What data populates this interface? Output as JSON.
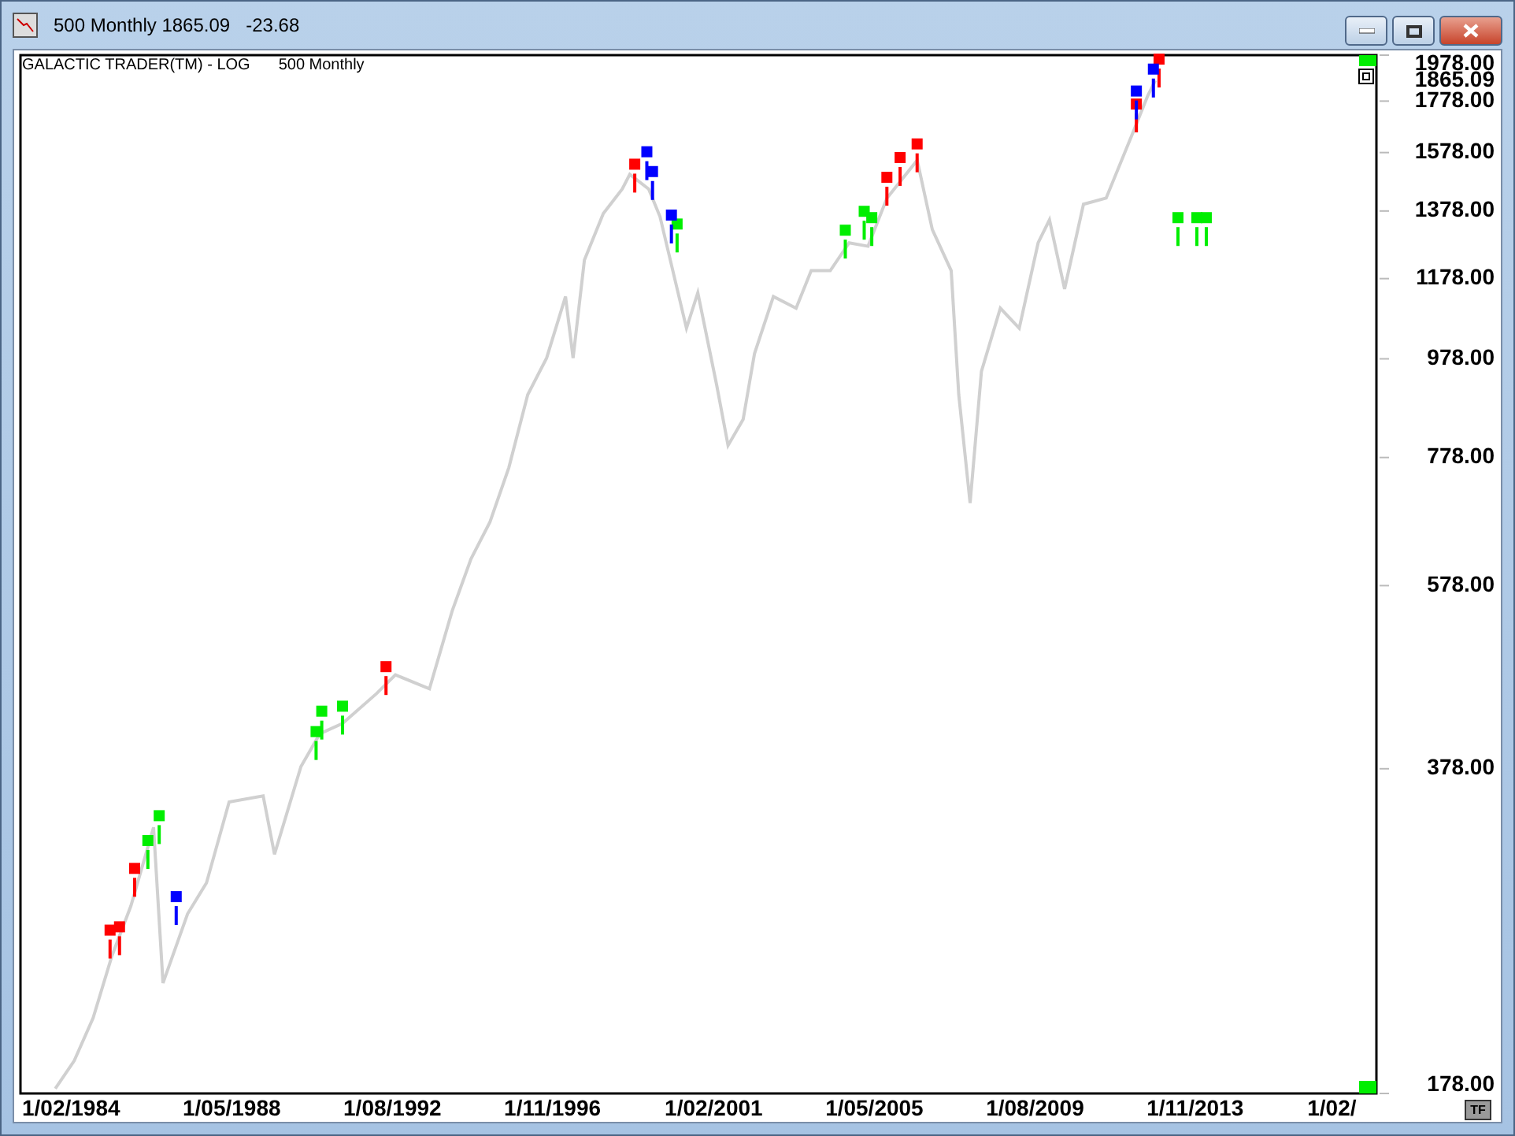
{
  "window": {
    "title": "500 Monthly 1865.09",
    "change": "-23.68",
    "buttons": [
      {
        "kind": "minimize"
      },
      {
        "kind": "maximize"
      },
      {
        "kind": "close"
      }
    ]
  },
  "chart": {
    "header": "GALACTIC TRADER(TM) - LOG",
    "symbol": "500 Monthly",
    "last_value": "1865.09",
    "corner_button": "TF",
    "y_axis_labels": [
      "1978.00",
      "1778.00",
      "1578.00",
      "1378.00",
      "1178.00",
      "978.00",
      "778.00",
      "578.00",
      "378.00",
      "178.00"
    ],
    "x_axis_labels": [
      "1/02/1984",
      "1/05/1988",
      "1/08/1992",
      "1/11/1996",
      "1/02/2001",
      "1/05/2005",
      "1/08/2009",
      "1/11/2013",
      "1/02/"
    ]
  }
}
